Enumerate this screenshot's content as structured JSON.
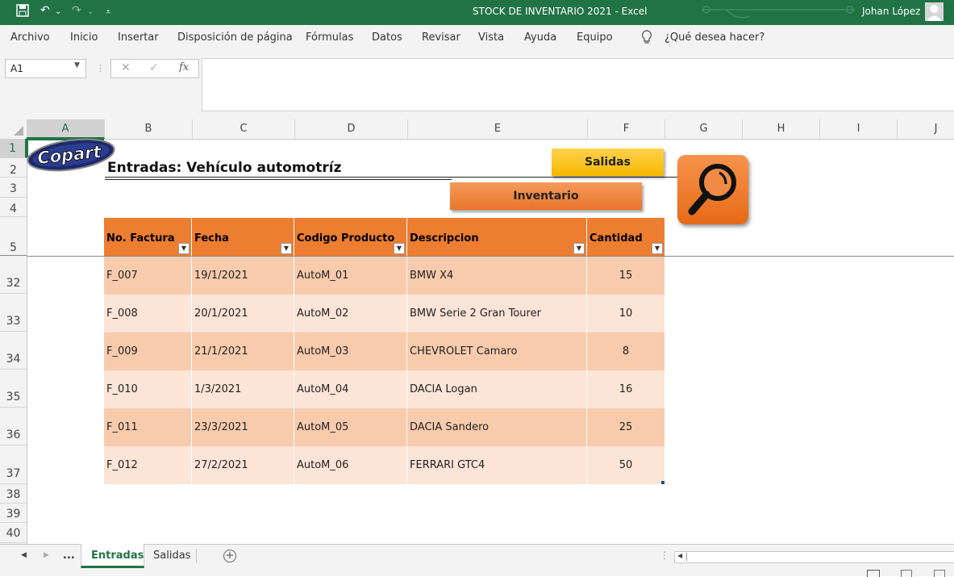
{
  "window": {
    "title": "STOCK DE INVENTARIO 2021  -  Excel",
    "user": "Johan López"
  },
  "ribbon": {
    "tabs": [
      "Archivo",
      "Inicio",
      "Insertar",
      "Disposición de página",
      "Fórmulas",
      "Datos",
      "Revisar",
      "Vista",
      "Ayuda",
      "Equipo"
    ],
    "tell_me": "¿Qué desea hacer?"
  },
  "formula_bar": {
    "name_box": "A1",
    "fx": "fx",
    "formula": ""
  },
  "columns": [
    "A",
    "B",
    "C",
    "D",
    "E",
    "F",
    "G",
    "H",
    "I",
    "J"
  ],
  "rows": [
    "1",
    "2",
    "3",
    "4",
    "5",
    "32",
    "33",
    "34",
    "35",
    "36",
    "37",
    "38",
    "39",
    "40"
  ],
  "sheet": {
    "logo_text": "Copart",
    "title": "Entradas: Vehículo automotríz",
    "buttons": {
      "salidas": "Salidas",
      "inventario": "Inventario"
    },
    "table": {
      "headers": [
        "No. Factura",
        "Fecha",
        "Codigo Producto",
        "Descripcion",
        "Cantidad"
      ],
      "rows": [
        [
          "F_007",
          "19/1/2021",
          "AutoM_01",
          "BMW X4",
          "15"
        ],
        [
          "F_008",
          "20/1/2021",
          "AutoM_02",
          "BMW Serie 2 Gran Tourer",
          "10"
        ],
        [
          "F_009",
          "21/1/2021",
          "AutoM_03",
          "CHEVROLET Camaro",
          "8"
        ],
        [
          "F_010",
          "1/3/2021",
          "AutoM_04",
          "DACIA Logan",
          "16"
        ],
        [
          "F_011",
          "23/3/2021",
          "AutoM_05",
          "DACIA Sandero",
          "25"
        ],
        [
          "F_012",
          "27/2/2021",
          "AutoM_06",
          "FERRARI GTC4",
          "50"
        ]
      ]
    }
  },
  "sheet_tabs": {
    "ellipsis": "...",
    "active": "Entradas",
    "other": "Salidas"
  },
  "colors": {
    "excel_green": "#217346",
    "header_orange": "#ed7d31",
    "row_dark": "#f8cbad",
    "row_light": "#fce4d6",
    "salidas_yellow": "#ffc000"
  }
}
